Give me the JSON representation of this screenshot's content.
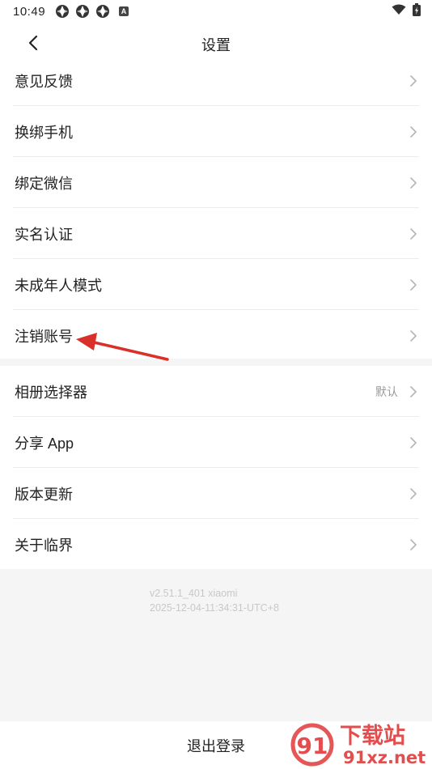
{
  "status_bar": {
    "time": "10:49",
    "badge": "A"
  },
  "header": {
    "title": "设置"
  },
  "group1": [
    {
      "label": "意见反馈"
    },
    {
      "label": "换绑手机"
    },
    {
      "label": "绑定微信"
    },
    {
      "label": "实名认证"
    },
    {
      "label": "未成年人模式"
    },
    {
      "label": "注销账号"
    }
  ],
  "group2": [
    {
      "label": "相册选择器",
      "value": "默认"
    },
    {
      "label": "分享 App"
    },
    {
      "label": "版本更新"
    },
    {
      "label": "关于临界"
    }
  ],
  "version": {
    "line1": "v2.51.1_401 xiaomi",
    "line2": "2025-12-04-11:34:31-UTC+8"
  },
  "logout_label": "退出登录",
  "watermark": {
    "brand": "下载站",
    "domain": "91xz.net",
    "mark": "91"
  },
  "colors": {
    "annotation_arrow": "#d9302a",
    "watermark_red": "#e03a3a",
    "text_primary": "#222222",
    "text_secondary": "#999999"
  }
}
